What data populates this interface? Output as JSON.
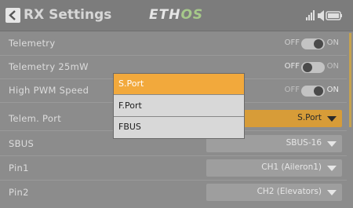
{
  "header": {
    "title": "RX Settings",
    "logo_main": "ETH",
    "logo_accent": "OS"
  },
  "rows": {
    "telemetry": {
      "label": "Telemetry",
      "off": "OFF",
      "on": "ON",
      "value": "ON"
    },
    "telemetry_25mw": {
      "label": "Telemetry 25mW",
      "off": "OFF",
      "on": "ON",
      "value": "OFF"
    },
    "high_pwm_speed": {
      "label": "High PWM Speed",
      "off": "OFF",
      "on": "ON",
      "value": "ON"
    },
    "telem_port": {
      "label": "Telem. Port",
      "value": "S.Port"
    },
    "sbus": {
      "label": "SBUS",
      "value": "SBUS-16"
    },
    "pin1": {
      "label": "Pin1",
      "value": "CH1 (Aileron1)"
    },
    "pin2": {
      "label": "Pin2",
      "value": "CH2 (Elevators)"
    }
  },
  "popup": {
    "options": [
      "S.Port",
      "F.Port",
      "FBUS"
    ],
    "selected": "S.Port"
  },
  "colors": {
    "accent": "#f2a93c",
    "background": "#8c8c8c"
  }
}
